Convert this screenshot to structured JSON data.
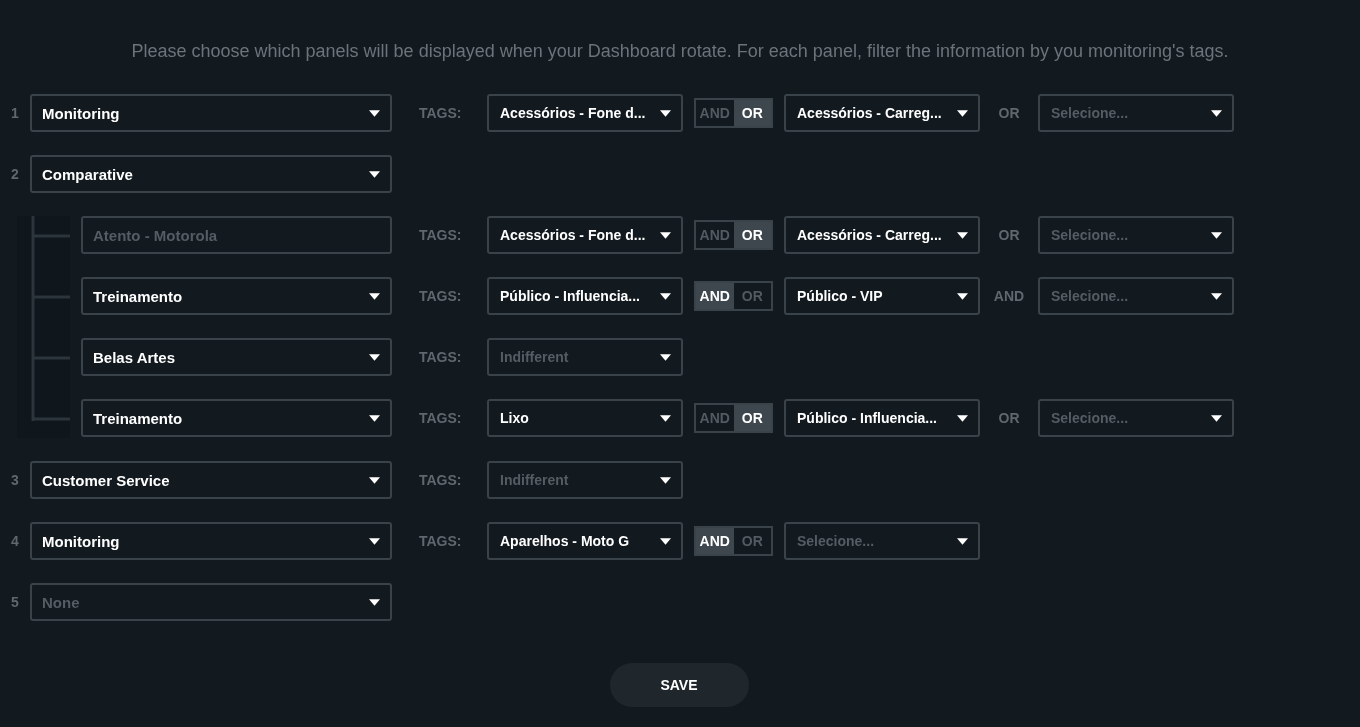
{
  "instructions": "Please choose which panels will be displayed when your Dashboard rotate. For each panel, filter the information by you monitoring's tags.",
  "panels": [
    {
      "number": "1",
      "field": {
        "kind": "select",
        "value": "Monitoring"
      },
      "tags": {
        "label": "TAGS:",
        "first": {
          "value": "Acessórios - Fone d..."
        },
        "operator": [
          {
            "label": "AND",
            "selected": false
          },
          {
            "label": "OR",
            "selected": true
          }
        ],
        "second": {
          "value": "Acessórios - Carreg..."
        },
        "joiner": "OR",
        "third": {
          "placeholder": "Selecione..."
        }
      }
    },
    {
      "number": "2",
      "field": {
        "kind": "select",
        "value": "Comparative"
      },
      "children": [
        {
          "field": {
            "kind": "input",
            "placeholder": "Atento - Motorola"
          },
          "tags": {
            "label": "TAGS:",
            "first": {
              "value": "Acessórios - Fone d..."
            },
            "operator": [
              {
                "label": "AND",
                "selected": false
              },
              {
                "label": "OR",
                "selected": true
              }
            ],
            "second": {
              "value": "Acessórios - Carreg..."
            },
            "joiner": "OR",
            "third": {
              "placeholder": "Selecione..."
            }
          }
        },
        {
          "field": {
            "kind": "select",
            "value": "Treinamento"
          },
          "tags": {
            "label": "TAGS:",
            "first": {
              "value": "Público - Influencia..."
            },
            "operator": [
              {
                "label": "AND",
                "selected": true
              },
              {
                "label": "OR",
                "selected": false
              }
            ],
            "second": {
              "value": "Público - VIP"
            },
            "joiner": "AND",
            "third": {
              "placeholder": "Selecione..."
            }
          }
        },
        {
          "field": {
            "kind": "select",
            "value": "Belas Artes"
          },
          "tags": {
            "label": "TAGS:",
            "first": {
              "placeholder": "Indifferent"
            }
          }
        },
        {
          "field": {
            "kind": "select",
            "value": "Treinamento"
          },
          "tags": {
            "label": "TAGS:",
            "first": {
              "value": "Lixo"
            },
            "operator": [
              {
                "label": "AND",
                "selected": false
              },
              {
                "label": "OR",
                "selected": true
              }
            ],
            "second": {
              "value": "Público - Influencia..."
            },
            "joiner": "OR",
            "third": {
              "placeholder": "Selecione..."
            }
          }
        }
      ]
    },
    {
      "number": "3",
      "field": {
        "kind": "select",
        "value": "Customer Service"
      },
      "tags": {
        "label": "TAGS:",
        "first": {
          "placeholder": "Indifferent"
        }
      }
    },
    {
      "number": "4",
      "field": {
        "kind": "select",
        "value": "Monitoring"
      },
      "tags": {
        "label": "TAGS:",
        "first": {
          "value": "Aparelhos - Moto G"
        },
        "operator": [
          {
            "label": "AND",
            "selected": true
          },
          {
            "label": "OR",
            "selected": false
          }
        ],
        "second": {
          "placeholder": "Selecione..."
        }
      }
    },
    {
      "number": "5",
      "field": {
        "kind": "select",
        "placeholder": "None"
      }
    }
  ],
  "save_button": "SAVE"
}
